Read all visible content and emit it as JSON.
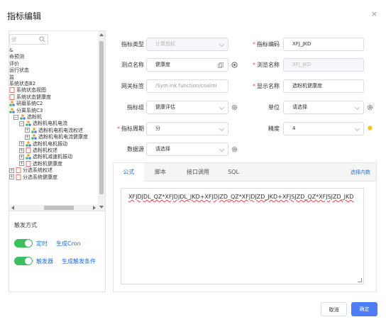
{
  "dialog": {
    "title": "指标编辑",
    "close_glyph": "×"
  },
  "tree": {
    "search_placeholder": "键",
    "items": [
      {
        "label": "&",
        "level": 0,
        "expander": "",
        "icon": ""
      },
      {
        "label": "命预测",
        "level": 0,
        "expander": "",
        "icon": ""
      },
      {
        "label": "评价",
        "level": 0,
        "expander": "",
        "icon": ""
      },
      {
        "label": "运行状态",
        "level": 0,
        "expander": "",
        "icon": ""
      },
      {
        "label": "监",
        "level": 0,
        "expander": "",
        "icon": ""
      },
      {
        "label": "系统状态B2",
        "level": 0,
        "expander": "",
        "icon": ""
      },
      {
        "label": "系统状态视图",
        "level": 0,
        "expander": "",
        "icon": "doc-icon"
      },
      {
        "label": "系统状态健康度",
        "level": 0,
        "expander": "",
        "icon": "doc-icon"
      },
      {
        "label": "研磨系统C2",
        "level": 0,
        "expander": "",
        "icon": "cluster-icon"
      },
      {
        "label": "分离系统C3",
        "level": 0,
        "expander": "",
        "icon": "cluster-icon"
      },
      {
        "label": "选粉机",
        "level": 1,
        "expander": "⊟",
        "icon": "cluster-icon"
      },
      {
        "label": "选粉机电机电流",
        "level": 2,
        "expander": "⊟",
        "icon": "cluster-icon"
      },
      {
        "label": "选粉机电机电流权述",
        "level": 3,
        "expander": "⊞",
        "icon": "cluster-icon"
      },
      {
        "label": "选粉机电机电流健康度",
        "level": 3,
        "expander": "⊞",
        "icon": "cluster-icon"
      },
      {
        "label": "选粉机电机振动",
        "level": 2,
        "expander": "⊞",
        "icon": "cluster-icon"
      },
      {
        "label": "选粉机权述",
        "level": 2,
        "expander": "⊞",
        "icon": "doc-icon"
      },
      {
        "label": "选粉机减速机振动",
        "level": 2,
        "expander": "⊞",
        "icon": "cluster-icon"
      },
      {
        "label": "选粉机健康度",
        "level": 2,
        "expander": "⊞",
        "icon": "doc-icon"
      },
      {
        "label": "分选系统权述",
        "level": 0,
        "expander": "⊞",
        "icon": "doc-icon"
      },
      {
        "label": "分选系统健康度",
        "level": 0,
        "expander": "⊞",
        "icon": "doc-icon"
      }
    ]
  },
  "trigger": {
    "title": "触发方式",
    "rows": [
      {
        "label": "定时",
        "action": "生成Cron",
        "on": true
      },
      {
        "label": "触发器",
        "action": "生成触发条件",
        "on": true
      }
    ]
  },
  "form": {
    "indicator_type": {
      "label": "指标类型",
      "value": "计算指标",
      "required": false
    },
    "indicator_code": {
      "label": "指标编码",
      "value": "XFJ_JKD",
      "required": true
    },
    "point_name": {
      "label": "测点名称",
      "value": "健康度",
      "required": false
    },
    "browse_name": {
      "label": "浏览名称",
      "value": "XFJ_JKD",
      "required": true
    },
    "gateway_tag": {
      "label": "网关标签",
      "value": "/Sym.ink function/coalmi",
      "required": false
    },
    "display_name": {
      "label": "显示名称",
      "value": "选粉机健康度",
      "required": true
    },
    "indicator_group": {
      "label": "指标组",
      "value": "健康评估",
      "required": false
    },
    "unit": {
      "label": "单位",
      "value": "请选择",
      "required": false
    },
    "period": {
      "label": "指标周期",
      "value": "分",
      "required": true
    },
    "precision": {
      "label": "精度",
      "value": "4",
      "required": false
    },
    "datasource": {
      "label": "数据源",
      "value": "请选择",
      "required": false
    }
  },
  "editor": {
    "tabs": [
      "公式",
      "脚本",
      "接口调用",
      "SQL"
    ],
    "active_tab": 0,
    "link": "选择内数",
    "formula": "XFJDJDL_QZ*XFJDJDL_JKD+XFJDJZD_QZ*XFJDJZD_JKD+XFJSJZD_QZ*XFJSJZD_JKD"
  },
  "buttons": {
    "cancel": "取消",
    "ok": "确定"
  },
  "colors": {
    "primary": "#4d7cf5",
    "link": "#1f6fd6",
    "switch_on": "#3cbf60",
    "required": "#f04c4c"
  }
}
